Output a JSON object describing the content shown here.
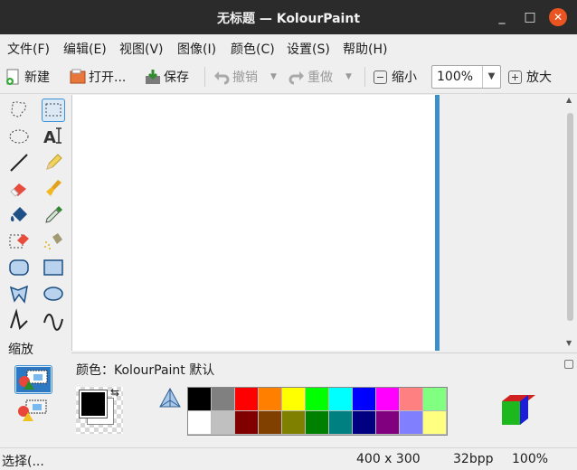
{
  "window": {
    "title": "无标题 — KolourPaint",
    "minimize_glyph": "_",
    "maximize_glyph": "□",
    "close_glyph": "✕"
  },
  "menus": [
    "文件(F)",
    "编辑(E)",
    "视图(V)",
    "图像(I)",
    "颜色(C)",
    "设置(S)",
    "帮助(H)"
  ],
  "toolbar": {
    "new_label": "新建",
    "open_label": "打开...",
    "save_label": "保存",
    "undo_label": "撤销",
    "redo_label": "重做",
    "zoom_out_label": "缩小",
    "zoom_value": "100%",
    "zoom_in_label": "放大"
  },
  "toolbox": {
    "zoom_label": "缩放",
    "tools": [
      "free-form-selection",
      "rectangular-selection",
      "elliptical-selection",
      "text",
      "line",
      "pen",
      "eraser",
      "brush",
      "flood-fill",
      "color-picker",
      "color-eraser",
      "spraycan",
      "rounded-rectangle",
      "rectangle",
      "polygon",
      "ellipse",
      "connected-lines",
      "curve"
    ]
  },
  "colors": {
    "label": "颜色：KolourPaint 默认",
    "foreground": "#000000",
    "background": "#ffffff",
    "palette_row1": [
      "#000000",
      "#808080",
      "#ff0000",
      "#ff8000",
      "#ffff00",
      "#00ff00",
      "#00ffff",
      "#0000ff",
      "#ff00ff",
      "#ff8080",
      "#80ff80"
    ],
    "palette_row2": [
      "#ffffff",
      "#c0c0c0",
      "#800000",
      "#804000",
      "#808000",
      "#008000",
      "#008080",
      "#000080",
      "#800080",
      "#8080ff",
      "#ffff80"
    ],
    "accent": "#3d8fc7"
  },
  "status": {
    "message": "选择(...",
    "dimensions": "400 x 300",
    "depth": "32bpp",
    "zoom": "100%"
  }
}
